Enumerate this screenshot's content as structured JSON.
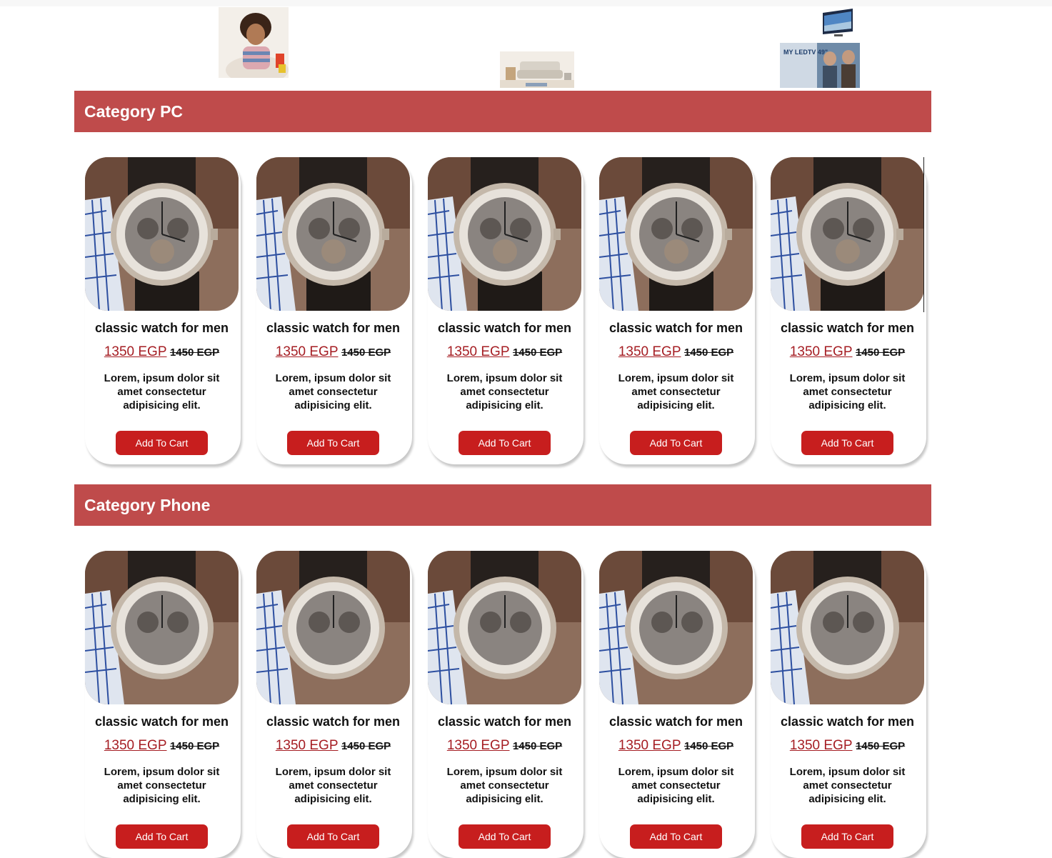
{
  "banners": [
    {
      "name": "kid-banner"
    },
    {
      "name": "sofa-banner"
    },
    {
      "name": "tv-banner"
    },
    {
      "name": "ledtv-banner",
      "text": "MY LEDTV 49\""
    }
  ],
  "categories": [
    {
      "title": "Category PC",
      "products": [
        {
          "title": "classic watch for men",
          "price": "1350 EGP",
          "old_price": "1450 EGP",
          "description": "Lorem, ipsum dolor sit amet consectetur adipisicing elit.",
          "button": "Add To Cart",
          "image": "watch-image"
        },
        {
          "title": "classic watch for men",
          "price": "1350 EGP",
          "old_price": "1450 EGP",
          "description": "Lorem, ipsum dolor sit amet consectetur adipisicing elit.",
          "button": "Add To Cart",
          "image": "watch-image"
        },
        {
          "title": "classic watch for men",
          "price": "1350 EGP",
          "old_price": "1450 EGP",
          "description": "Lorem, ipsum dolor sit amet consectetur adipisicing elit.",
          "button": "Add To Cart",
          "image": "watch-image"
        },
        {
          "title": "classic watch for men",
          "price": "1350 EGP",
          "old_price": "1450 EGP",
          "description": "Lorem, ipsum dolor sit amet consectetur adipisicing elit.",
          "button": "Add To Cart",
          "image": "watch-image"
        },
        {
          "title": "classic watch for men",
          "price": "1350 EGP",
          "old_price": "1450 EGP",
          "description": "Lorem, ipsum dolor sit amet consectetur adipisicing elit.",
          "button": "Add To Cart",
          "image": "watch-image"
        }
      ]
    },
    {
      "title": "Category Phone",
      "products": [
        {
          "title": "classic watch for men",
          "price": "1350 EGP",
          "old_price": "1450 EGP",
          "description": "Lorem, ipsum dolor sit amet consectetur adipisicing elit.",
          "button": "Add To Cart",
          "image": "watch-image"
        },
        {
          "title": "classic watch for men",
          "price": "1350 EGP",
          "old_price": "1450 EGP",
          "description": "Lorem, ipsum dolor sit amet consectetur adipisicing elit.",
          "button": "Add To Cart",
          "image": "watch-image"
        },
        {
          "title": "classic watch for men",
          "price": "1350 EGP",
          "old_price": "1450 EGP",
          "description": "Lorem, ipsum dolor sit amet consectetur adipisicing elit.",
          "button": "Add To Cart",
          "image": "watch-image"
        },
        {
          "title": "classic watch for men",
          "price": "1350 EGP",
          "old_price": "1450 EGP",
          "description": "Lorem, ipsum dolor sit amet consectetur adipisicing elit.",
          "button": "Add To Cart",
          "image": "watch-image"
        },
        {
          "title": "classic watch for men",
          "price": "1350 EGP",
          "old_price": "1450 EGP",
          "description": "Lorem, ipsum dolor sit amet consectetur adipisicing elit.",
          "button": "Add To Cart",
          "image": "watch-image"
        }
      ]
    }
  ],
  "colors": {
    "category_header": "#bf4b4b",
    "button": "#c71e1e",
    "price_new": "#a51d23"
  }
}
